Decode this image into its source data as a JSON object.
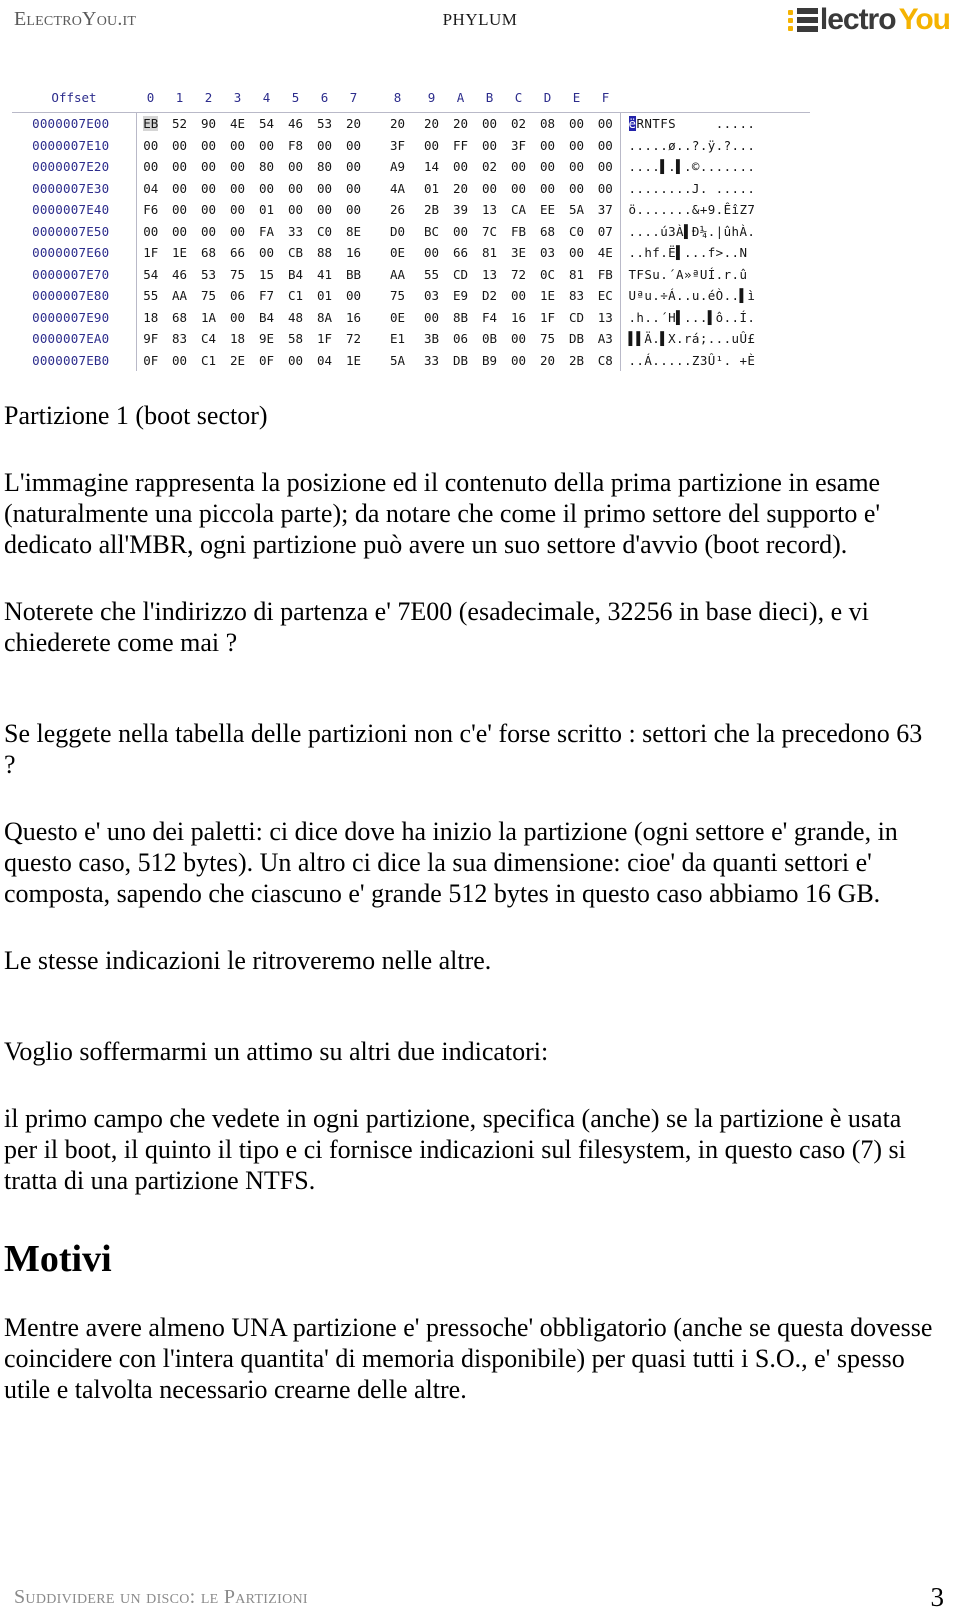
{
  "header": {
    "brand_left": "ElectroYou.it",
    "doc_title": "PHYLUM",
    "logo": {
      "text_part1": "lectro",
      "text_part2": "You",
      "accent_color": "#f5b301",
      "dark_color": "#3a3a3a"
    }
  },
  "hexdump": {
    "offset_header": "Offset",
    "byte_columns": [
      "0",
      "1",
      "2",
      "3",
      "4",
      "5",
      "6",
      "7",
      "8",
      "9",
      "A",
      "B",
      "C",
      "D",
      "E",
      "F"
    ],
    "rows": [
      {
        "offset": "0000007E00",
        "bytes": [
          "EB",
          "52",
          "90",
          "4E",
          "54",
          "46",
          "53",
          "20",
          "20",
          "20",
          "20",
          "00",
          "02",
          "08",
          "00",
          "00"
        ],
        "ascii": "ëRNTFS     ....."
      },
      {
        "offset": "0000007E10",
        "bytes": [
          "00",
          "00",
          "00",
          "00",
          "00",
          "F8",
          "00",
          "00",
          "3F",
          "00",
          "FF",
          "00",
          "3F",
          "00",
          "00",
          "00"
        ],
        "ascii": ".....ø..?.ÿ.?..."
      },
      {
        "offset": "0000007E20",
        "bytes": [
          "00",
          "00",
          "00",
          "00",
          "80",
          "00",
          "80",
          "00",
          "A9",
          "14",
          "00",
          "02",
          "00",
          "00",
          "00",
          "00"
        ],
        "ascii": "....▌.▌.©......."
      },
      {
        "offset": "0000007E30",
        "bytes": [
          "04",
          "00",
          "00",
          "00",
          "00",
          "00",
          "00",
          "00",
          "4A",
          "01",
          "20",
          "00",
          "00",
          "00",
          "00",
          "00"
        ],
        "ascii": "........J. ....."
      },
      {
        "offset": "0000007E40",
        "bytes": [
          "F6",
          "00",
          "00",
          "00",
          "01",
          "00",
          "00",
          "00",
          "26",
          "2B",
          "39",
          "13",
          "CA",
          "EE",
          "5A",
          "37"
        ],
        "ascii": "ö.......&+9.ÊîZ7"
      },
      {
        "offset": "0000007E50",
        "bytes": [
          "00",
          "00",
          "00",
          "00",
          "FA",
          "33",
          "C0",
          "8E",
          "D0",
          "BC",
          "00",
          "7C",
          "FB",
          "68",
          "C0",
          "07"
        ],
        "ascii": "....ú3À▌Ð¼.|ûhÀ."
      },
      {
        "offset": "0000007E60",
        "bytes": [
          "1F",
          "1E",
          "68",
          "66",
          "00",
          "CB",
          "88",
          "16",
          "0E",
          "00",
          "66",
          "81",
          "3E",
          "03",
          "00",
          "4E"
        ],
        "ascii": "..hf.Ë▌...f>..N"
      },
      {
        "offset": "0000007E70",
        "bytes": [
          "54",
          "46",
          "53",
          "75",
          "15",
          "B4",
          "41",
          "BB",
          "AA",
          "55",
          "CD",
          "13",
          "72",
          "0C",
          "81",
          "FB"
        ],
        "ascii": "TFSu.´A»ªUÍ.r.û"
      },
      {
        "offset": "0000007E80",
        "bytes": [
          "55",
          "AA",
          "75",
          "06",
          "F7",
          "C1",
          "01",
          "00",
          "75",
          "03",
          "E9",
          "D2",
          "00",
          "1E",
          "83",
          "EC"
        ],
        "ascii": "Uªu.÷Á..u.éÒ..▌ì"
      },
      {
        "offset": "0000007E90",
        "bytes": [
          "18",
          "68",
          "1A",
          "00",
          "B4",
          "48",
          "8A",
          "16",
          "0E",
          "00",
          "8B",
          "F4",
          "16",
          "1F",
          "CD",
          "13"
        ],
        "ascii": ".h..´H▌...▌ô..Í."
      },
      {
        "offset": "0000007EA0",
        "bytes": [
          "9F",
          "83",
          "C4",
          "18",
          "9E",
          "58",
          "1F",
          "72",
          "E1",
          "3B",
          "06",
          "0B",
          "00",
          "75",
          "DB",
          "A3"
        ],
        "ascii": "▌▌Ä.▌X.rá;...uÛ£"
      },
      {
        "offset": "0000007EB0",
        "bytes": [
          "0F",
          "00",
          "C1",
          "2E",
          "0F",
          "00",
          "04",
          "1E",
          "5A",
          "33",
          "DB",
          "B9",
          "00",
          "20",
          "2B",
          "C8"
        ],
        "ascii": "..Á.....Z3Û¹. +È"
      }
    ]
  },
  "article": {
    "paragraphs": [
      "Partizione 1 (boot sector)",
      "L'immagine rappresenta la posizione ed il contenuto della prima partizione in esame (naturalmente una piccola parte); da notare che come il primo settore del supporto e' dedicato all'MBR, ogni partizione può avere un suo settore d'avvio (boot record).",
      "Noterete che l'indirizzo di partenza e' 7E00 (esadecimale, 32256 in base dieci), e vi chiederete come mai ?",
      "Se leggete nella tabella delle partizioni non c'e' forse scritto : settori che la precedono 63 ?",
      "Questo e' uno dei paletti: ci dice dove ha inizio la partizione (ogni settore e' grande, in questo caso, 512 bytes). Un altro ci dice la sua dimensione: cioe' da quanti settori e' composta, sapendo che ciascuno e' grande 512 bytes in questo caso abbiamo 16 GB.",
      "Le stesse indicazioni le ritroveremo nelle altre.",
      "Voglio soffermarmi un attimo su altri due indicatori:",
      "il primo campo che vedete in ogni partizione, specifica (anche) se la partizione è usata per il boot, il quinto il tipo e ci fornisce indicazioni sul filesystem, in questo caso (7) si tratta di una partizione NTFS."
    ],
    "section_heading": "Motivi",
    "closing_paragraph": "Mentre avere almeno UNA partizione e' pressoche' obbligatorio (anche se questa dovesse coincidere con l'intera quantita' di memoria disponibile) per quasi tutti i S.O., e' spesso utile e talvolta necessario crearne delle altre."
  },
  "footer": {
    "caption": "Suddividere un disco: le Partizioni",
    "page_number": "3"
  }
}
